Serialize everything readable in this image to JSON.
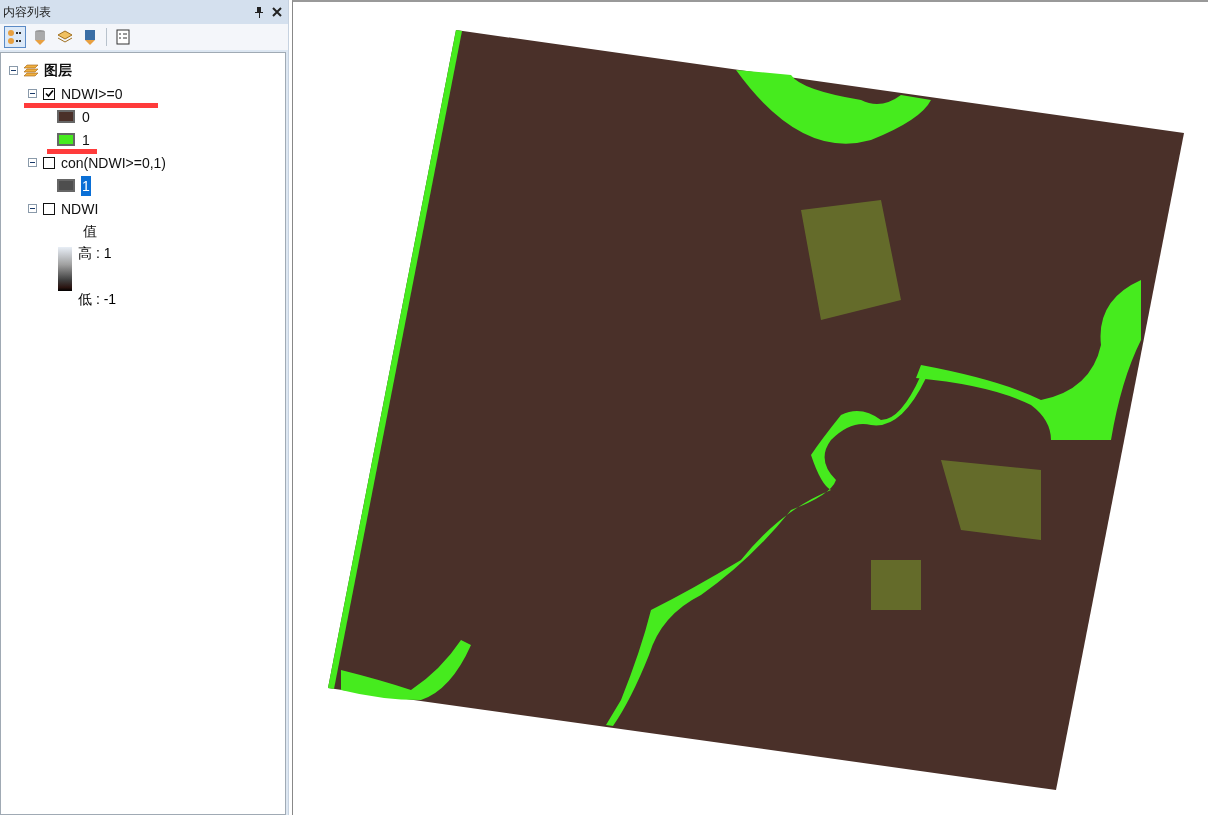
{
  "panel": {
    "title": "内容列表"
  },
  "toolbar": [
    {
      "selected": true
    },
    {
      "selected": false
    },
    {
      "selected": false
    },
    {
      "selected": false
    },
    {
      "selected": false
    }
  ],
  "tree": {
    "label": "图层",
    "expanded": true,
    "children": [
      {
        "label": "NDWI>=0",
        "checked": true,
        "expanded": true,
        "kind": "classes",
        "underlined": true,
        "legend": [
          {
            "label": "0",
            "color": "#4a3029",
            "selected": false,
            "underlined": false
          },
          {
            "label": "1",
            "color": "#46eb1e",
            "selected": false,
            "underlined": true
          }
        ]
      },
      {
        "label": "con(NDWI>=0,1)",
        "checked": false,
        "expanded": true,
        "kind": "classes",
        "underlined": false,
        "legend": [
          {
            "label": "1",
            "color": "#4e4e4e",
            "selected": true,
            "underlined": false
          }
        ]
      },
      {
        "label": "NDWI",
        "checked": false,
        "expanded": true,
        "kind": "stretch",
        "underlined": false,
        "heading": "值",
        "high": "高 : 1",
        "low": "低 : -1"
      }
    ]
  }
}
